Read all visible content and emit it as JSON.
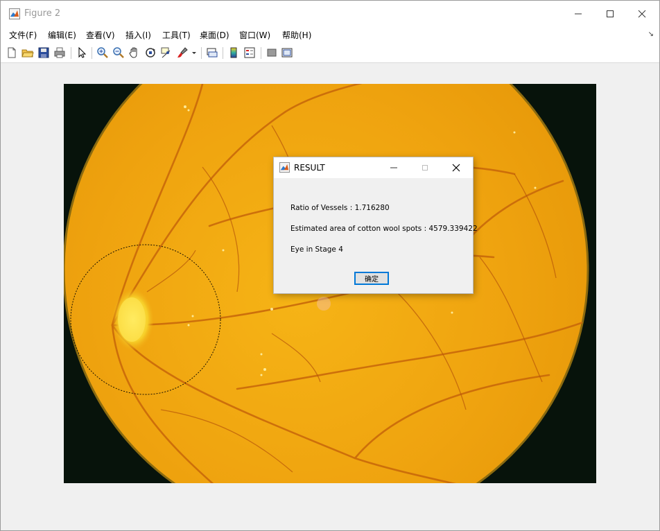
{
  "window": {
    "title": "Figure 2"
  },
  "menubar": {
    "items": [
      {
        "label": "文件(F)"
      },
      {
        "label": "编辑(E)"
      },
      {
        "label": "查看(V)"
      },
      {
        "label": "插入(I)"
      },
      {
        "label": "工具(T)"
      },
      {
        "label": "桌面(D)"
      },
      {
        "label": "窗口(W)"
      },
      {
        "label": "帮助(H)"
      }
    ]
  },
  "toolbar": {
    "icons": [
      "new-figure-icon",
      "open-file-icon",
      "save-icon",
      "print-icon",
      "edit-plot-icon",
      "zoom-in-icon",
      "zoom-out-icon",
      "pan-icon",
      "rotate-3d-icon",
      "data-cursor-icon",
      "brush-icon",
      "brush-dropdown-icon",
      "link-plot-icon",
      "insert-colorbar-icon",
      "insert-legend-icon",
      "hide-plot-tools-icon",
      "show-plot-tools-icon"
    ]
  },
  "dialog": {
    "title": "RESULT",
    "lines": [
      "Ratio of Vessels : 1.716280",
      "Estimated area of cotton wool spots : 4579.339422",
      "Eye in Stage 4"
    ],
    "ok_label": "确定"
  },
  "colors": {
    "fundus_background": "#07130b",
    "retina": "#f0a010",
    "accent": "#0078d7"
  }
}
